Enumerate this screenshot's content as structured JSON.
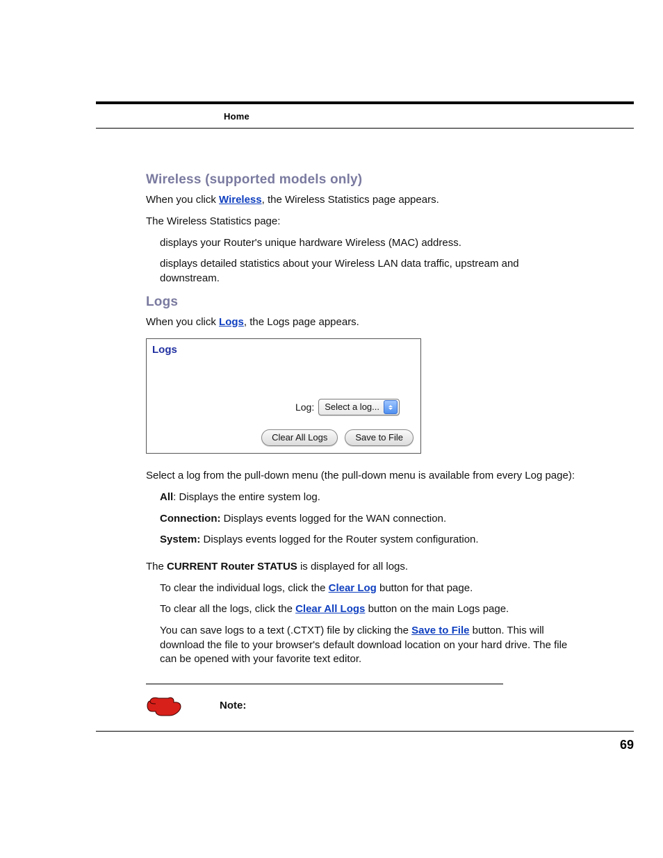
{
  "header": {
    "breadcrumb": "Home"
  },
  "page_number": "69",
  "wireless": {
    "heading": "Wireless (supported models only)",
    "p1a": "When you click ",
    "p1_link": "Wireless",
    "p1b": ", the Wireless Statistics page appears.",
    "p2": "The Wireless Statistics page:",
    "bullet1": "displays your Router's unique hardware Wireless (MAC) address.",
    "bullet2": "displays detailed statistics about your Wireless LAN data traffic, upstream and downstream."
  },
  "logs": {
    "heading": "Logs",
    "intro_a": "When you click ",
    "intro_link": "Logs",
    "intro_b": ", the Logs page appears.",
    "panel": {
      "title": "Logs",
      "select_label": "Log:",
      "select_value": "Select a log...",
      "btn_clear_all": "Clear All Logs",
      "btn_save": "Save to File"
    },
    "select_desc": "Select a log from the pull-down menu (the pull-down menu is available from every Log page):",
    "all_label": "All",
    "all_desc": ": Displays the entire system log.",
    "conn_label": "Connection:",
    "conn_desc": " Displays events logged for the WAN connection.",
    "sys_label": "System:",
    "sys_desc": " Displays events logged for the Router system configuration.",
    "status_a": "The ",
    "status_b": "CURRENT Router STATUS",
    "status_c": " is displayed for all logs.",
    "clear1a": "To clear the individual logs, click the ",
    "clear1_link": "Clear Log",
    "clear1b": " button for that page.",
    "clear2a": "To clear all the logs, click the ",
    "clear2_link": "Clear All Logs",
    "clear2b": " button on the main Logs page.",
    "save_a": "You can save logs to a text (.CTXT) file by clicking the ",
    "save_link": "Save to File",
    "save_b": " button. This will download the file to your browser's default download location on your hard drive. The file can be opened with your favorite text editor.",
    "note_label": "Note:"
  }
}
